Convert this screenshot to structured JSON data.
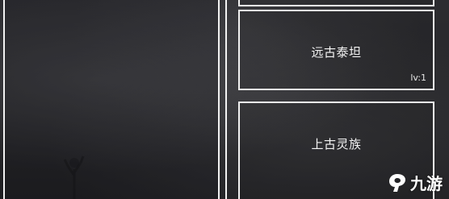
{
  "cards": [
    {
      "title": "",
      "level": ""
    },
    {
      "title": "远古泰坦",
      "level": "lv:1"
    },
    {
      "title": "上古灵族",
      "level": ""
    }
  ],
  "watermark": {
    "text": "九游",
    "icon": "jiuyou-logo-icon"
  },
  "colors": {
    "border": "#f2f2f2",
    "text": "#f4f4f4",
    "background": "#26262a"
  }
}
